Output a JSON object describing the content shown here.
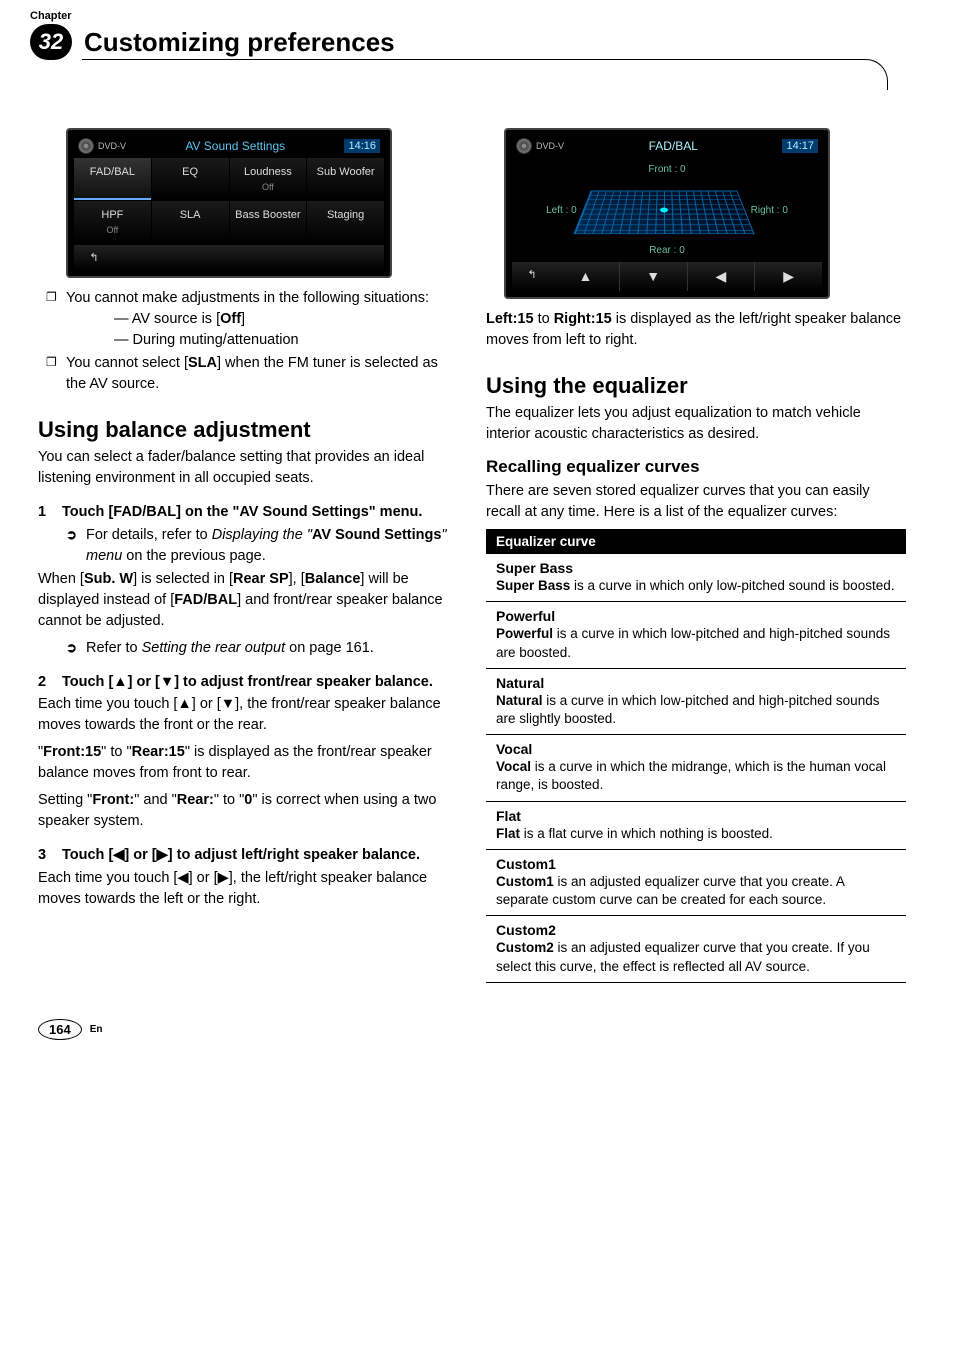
{
  "header": {
    "chapter_label": "Chapter",
    "chapter_number": "32",
    "title": "Customizing preferences"
  },
  "ss1": {
    "source": "DVD-V",
    "title": "AV Sound Settings",
    "time": "14:16",
    "cells": [
      {
        "label": "FAD/BAL",
        "sub": ""
      },
      {
        "label": "EQ",
        "sub": ""
      },
      {
        "label": "Loudness",
        "sub": "Off"
      },
      {
        "label": "Sub Woofer",
        "sub": ""
      },
      {
        "label": "HPF",
        "sub": "Off"
      },
      {
        "label": "SLA",
        "sub": ""
      },
      {
        "label": "Bass Booster",
        "sub": ""
      },
      {
        "label": "Staging",
        "sub": ""
      }
    ],
    "back": "↰"
  },
  "left": {
    "b1_pre": "You cannot make adjustments in the following situations:",
    "d1": "AV source is [",
    "d1b": "Off",
    "d1_post": "]",
    "d2": "During muting/attenuation",
    "b2_pre": "You cannot select [",
    "b2b": "SLA",
    "b2_post": "] when the FM tuner is selected as the AV source.",
    "h2": "Using balance adjustment",
    "p1": "You can select a fader/balance setting that provides an ideal listening environment in all occupied seats.",
    "s1": "Touch [FAD/BAL] on the \"AV Sound Settings\" menu.",
    "ptr1_pre": "For details, refer to ",
    "ptr1_it": "Displaying the \"",
    "ptr1_b": "AV Sound Settings",
    "ptr1_it2": "\" menu",
    "ptr1_post": " on the previous page.",
    "p2_pre": "When [",
    "p2_b1": "Sub. W",
    "p2_mid": "] is selected in [",
    "p2_b2": "Rear SP",
    "p2_mid2": "], [",
    "p2_b3": "Balance",
    "p2_mid3": "] will be displayed instead of [",
    "p2_b4": "FAD/BAL",
    "p2_post": "] and front/rear speaker balance cannot be adjusted.",
    "ptr2_pre": "Refer to ",
    "ptr2_it": "Setting the rear output",
    "ptr2_post": " on page 161.",
    "s2": "Touch [▲] or [▼] to adjust front/rear speaker balance.",
    "p3": "Each time you touch [▲] or [▼], the front/rear speaker balance moves towards the front or the rear.",
    "p4_pre": "\"",
    "p4_b1": "Front:15",
    "p4_mid": "\" to \"",
    "p4_b2": "Rear:15",
    "p4_post": "\" is displayed as the front/rear speaker balance moves from front to rear.",
    "p5_pre": "Setting \"",
    "p5_b1": "Front:",
    "p5_mid": "\" and \"",
    "p5_b2": "Rear:",
    "p5_mid2": "\" to \"",
    "p5_b3": "0",
    "p5_post": "\" is correct when using a two speaker system.",
    "s3": "Touch [◀] or [▶] to adjust left/right speaker balance.",
    "p6": "Each time you touch [◀] or [▶], the left/right speaker balance moves towards the left or the right."
  },
  "ss2": {
    "source": "DVD-V",
    "title": "FAD/BAL",
    "time": "14:17",
    "front": "Front :  0",
    "rear": "Rear :  0",
    "left": "Left :  0",
    "right": "Right :  0",
    "back": "↰",
    "up": "▲",
    "down": "▼",
    "l": "◀",
    "r": "▶"
  },
  "right": {
    "p1_b1": "Left:15",
    "p1_mid": " to ",
    "p1_b2": "Right:15",
    "p1_post": " is displayed as the left/right speaker balance moves from left to right.",
    "h2": "Using the equalizer",
    "p2": "The equalizer lets you adjust equalization to match vehicle interior acoustic characteristics as desired.",
    "h3": "Recalling equalizer curves",
    "p3": "There are seven stored equalizer curves that you can easily recall at any time. Here is a list of the equalizer curves:",
    "th": "Equalizer curve",
    "rows": [
      {
        "name": "Super Bass",
        "b": "Super Bass",
        "desc": " is a curve in which only low-pitched sound is boosted."
      },
      {
        "name": "Powerful",
        "b": "Powerful",
        "desc": " is a curve in which low-pitched and high-pitched sounds are boosted."
      },
      {
        "name": "Natural",
        "b": "Natural",
        "desc": " is a curve in which low-pitched and high-pitched sounds are slightly boosted."
      },
      {
        "name": "Vocal",
        "b": "Vocal",
        "desc": " is a curve in which the midrange, which is the human vocal range, is boosted."
      },
      {
        "name": "Flat",
        "b": "Flat",
        "desc": " is a flat curve in which nothing is boosted."
      },
      {
        "name": "Custom1",
        "b": "Custom1",
        "desc": " is an adjusted equalizer curve that you create. A separate custom curve can be created for each source."
      },
      {
        "name": "Custom2",
        "b": "Custom2",
        "desc": " is an adjusted equalizer curve that you create. If you select this curve, the effect is reflected all AV source."
      }
    ]
  },
  "foot": {
    "page": "164",
    "lang": "En"
  }
}
